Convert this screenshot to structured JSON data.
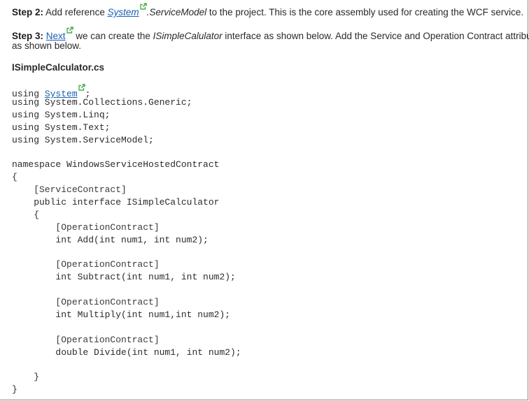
{
  "step2": {
    "label": "Step 2:",
    "text_before": " Add reference ",
    "link": "System",
    "text_italic": ".ServiceModel",
    "text_after": " to the project. This is the core assembly used for creating the WCF service."
  },
  "step3": {
    "label": "Step 3:",
    "link": "Next",
    "text_before": " we can create the ",
    "text_italic": "ISimpleCalulator",
    "text_after": " interface as shown below. Add the Service and Operation Contract attribute",
    "line2": "as shown below."
  },
  "filename": "ISimpleCalculator.cs",
  "code": {
    "l1_pre": "using ",
    "l1_link": "System",
    "l1_post": ";",
    "lines": [
      "using System.Collections.Generic;",
      "using System.Linq;",
      "using System.Text;",
      "using System.ServiceModel;",
      "",
      "namespace WindowsServiceHostedContract",
      "{",
      "    [ServiceContract]",
      "    public interface ISimpleCalculator",
      "    {",
      "        [OperationContract]",
      "        int Add(int num1, int num2);",
      "",
      "        [OperationContract]",
      "        int Subtract(int num1, int num2);",
      "",
      "        [OperationContract]",
      "        int Multiply(int num1,int num2);",
      "",
      "        [OperationContract]",
      "        double Divide(int num1, int num2);",
      "",
      "    }",
      "}"
    ]
  },
  "colors": {
    "link": "#1a5fb4",
    "external_icon": "#4caf50"
  },
  "icons": {
    "external_link": "external-link-icon"
  }
}
